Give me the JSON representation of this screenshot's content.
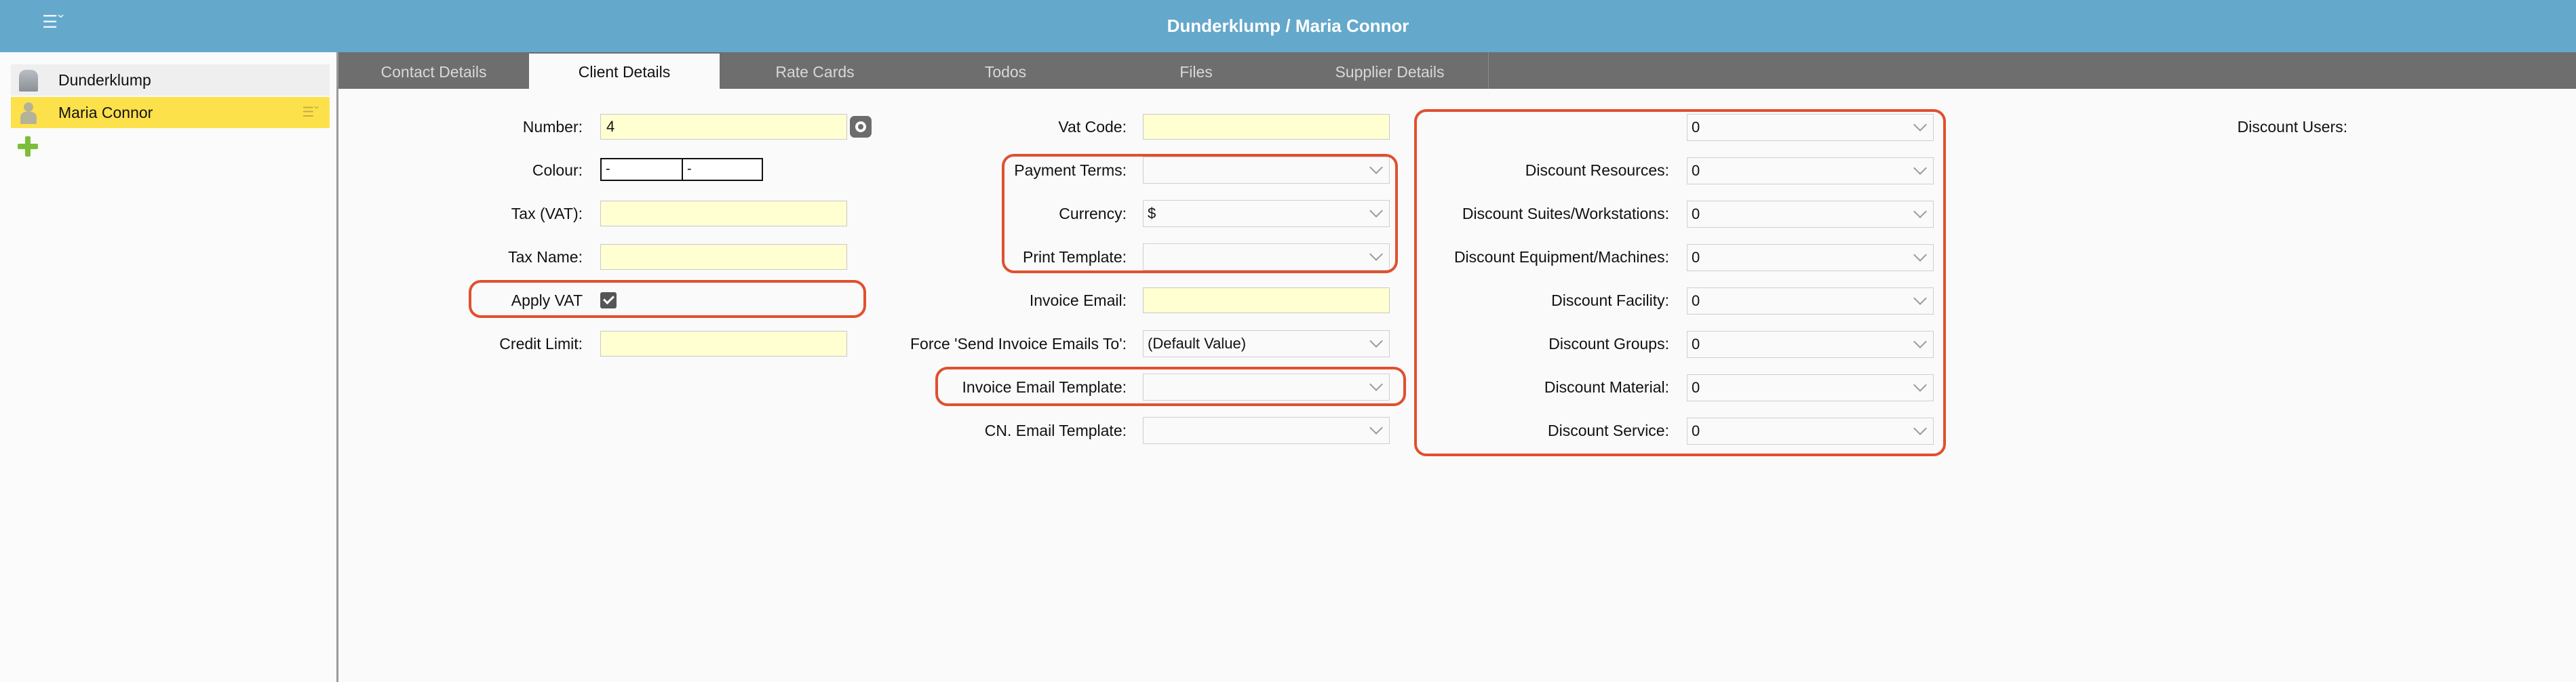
{
  "window": {
    "title": "Dunderklump / Maria Connor",
    "menu_icon": "list-menu-icon"
  },
  "sidebar": {
    "items": [
      {
        "label": "Dunderklump",
        "icon": "organization-icon"
      },
      {
        "label": "Maria Connor",
        "icon": "person-icon",
        "selected": true
      }
    ],
    "add_icon": "plus-icon"
  },
  "tabs": [
    {
      "label": "Contact Details"
    },
    {
      "label": "Client Details",
      "active": true
    },
    {
      "label": "Rate Cards"
    },
    {
      "label": "Todos"
    },
    {
      "label": "Files"
    },
    {
      "label": "Supplier Details"
    }
  ],
  "col1": {
    "number": {
      "label": "Number:",
      "value": "4"
    },
    "colour": {
      "label": "Colour:",
      "value1": "-",
      "value2": "-"
    },
    "tax_vat": {
      "label": "Tax (VAT):",
      "value": ""
    },
    "tax_name": {
      "label": "Tax Name:",
      "value": ""
    },
    "apply_vat": {
      "label": "Apply VAT",
      "checked": true
    },
    "credit_limit": {
      "label": "Credit Limit:",
      "value": ""
    }
  },
  "col2": {
    "vat_code": {
      "label": "Vat Code:",
      "value": ""
    },
    "payment_terms": {
      "label": "Payment Terms:",
      "value": ""
    },
    "currency": {
      "label": "Currency:",
      "value": "$"
    },
    "print_template": {
      "label": "Print Template:",
      "value": ""
    },
    "invoice_email": {
      "label": "Invoice Email:",
      "value": ""
    },
    "force_send": {
      "label": "Force 'Send Invoice Emails To':",
      "value": "(Default Value)"
    },
    "invoice_email_template": {
      "label": "Invoice Email Template:",
      "value": ""
    },
    "cn_email_template": {
      "label": "CN. Email Template:",
      "value": ""
    }
  },
  "col3": {
    "discounts": [
      {
        "label": "Discount Users:",
        "value": "0"
      },
      {
        "label": "Discount Resources:",
        "value": "0"
      },
      {
        "label": "Discount Suites/Workstations:",
        "value": "0"
      },
      {
        "label": "Discount Equipment/Machines:",
        "value": "0"
      },
      {
        "label": "Discount Facility:",
        "value": "0"
      },
      {
        "label": "Discount Groups:",
        "value": "0"
      },
      {
        "label": "Discount Material:",
        "value": "0"
      },
      {
        "label": "Discount Service:",
        "value": "0"
      }
    ]
  },
  "colors": {
    "titlebar": "#64a8cc",
    "selected_row": "#fde14b",
    "input_bg": "#ffffd2",
    "highlight": "#e0502e",
    "tabbar": "#6e6e6e"
  }
}
